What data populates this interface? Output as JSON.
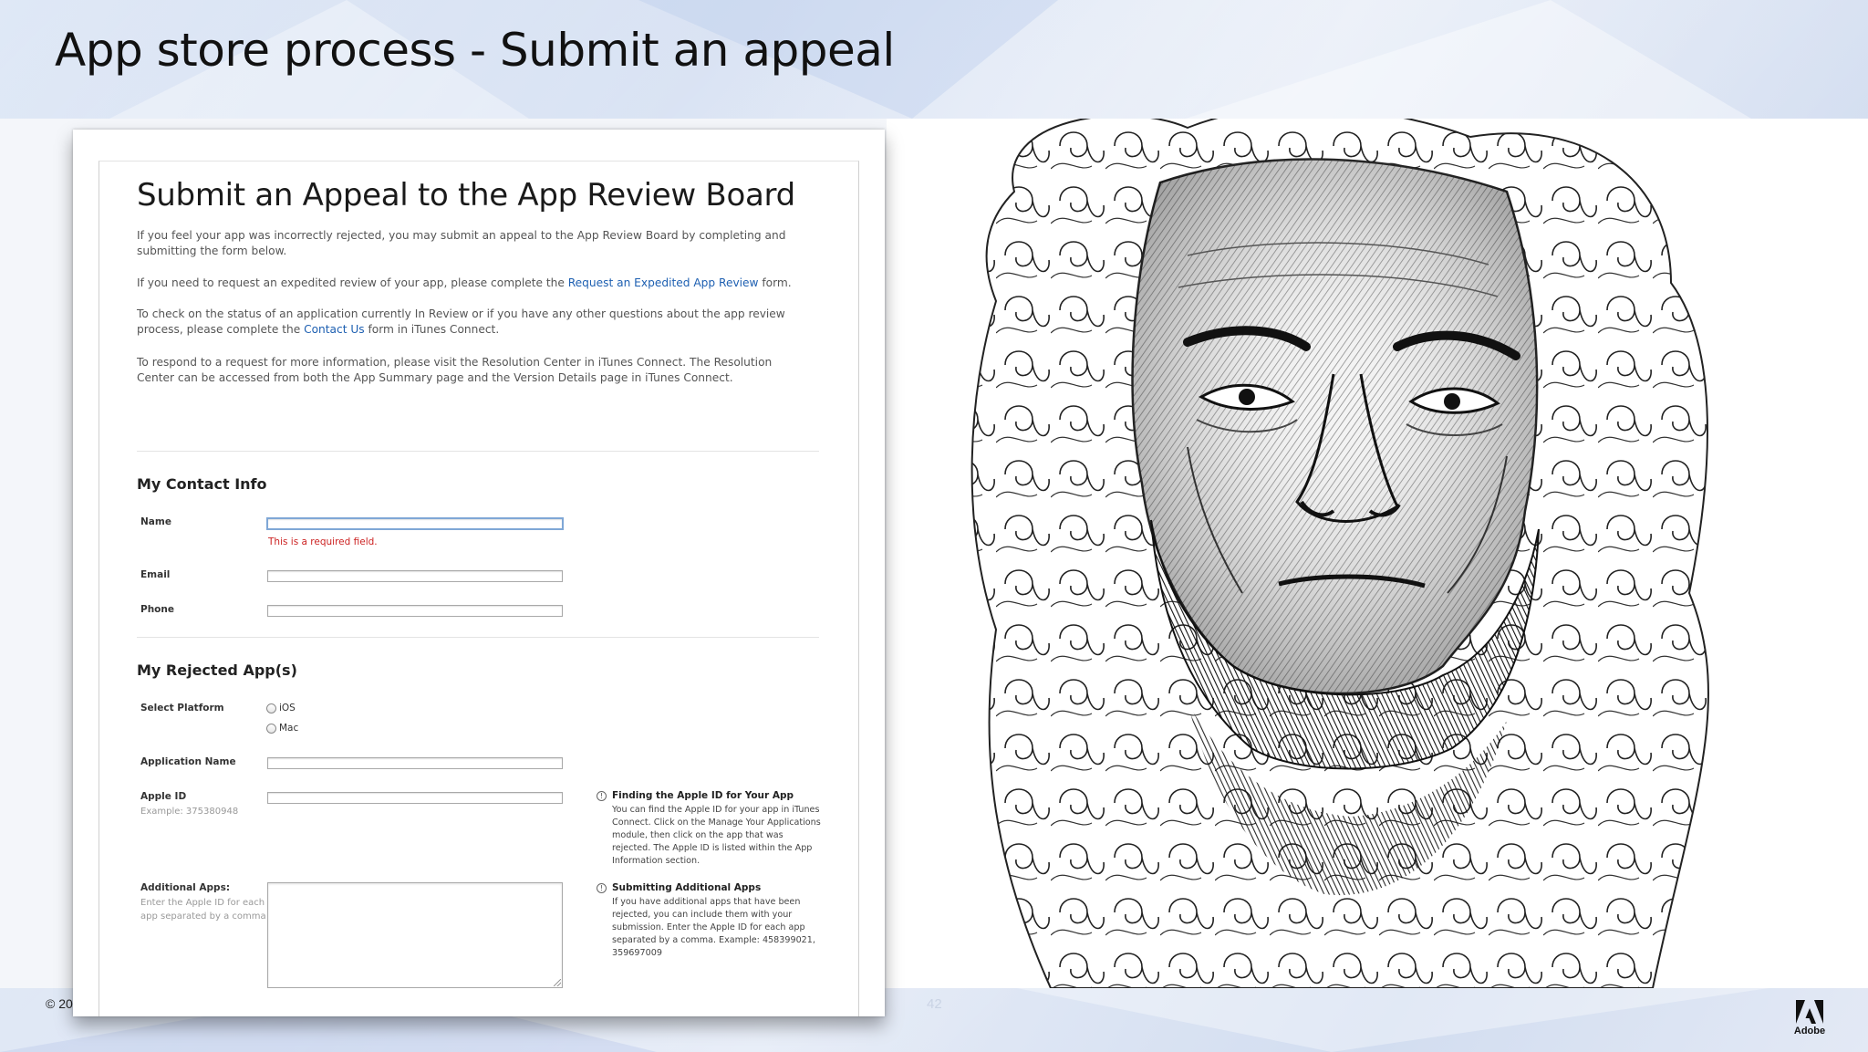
{
  "slide": {
    "title": "App store process - Submit an appeal",
    "copyright": "© 20",
    "page_number": "42",
    "brand": "Adobe"
  },
  "form": {
    "title": "Submit an Appeal to the App Review Board",
    "para1": "If you feel your app was incorrectly rejected, you may submit an appeal to the App Review Board by completing and submitting the form below.",
    "para2_before": "If you need to request an expedited review of your app, please complete the ",
    "para2_link": "Request an Expedited App Review",
    "para2_after": " form.",
    "para3_before": "To check on the status of an application currently In Review or if you have any other questions about the app review process, please complete the ",
    "para3_link": "Contact Us",
    "para3_after": " form in iTunes Connect.",
    "para4": "To respond to a request for more information, please visit the Resolution Center in iTunes Connect. The Resolution Center can be accessed from both the App Summary page and the Version Details page in iTunes Connect.",
    "contact_section": "My Contact Info",
    "name_label": "Name",
    "name_value": "",
    "name_error": "This is a required field.",
    "email_label": "Email",
    "email_value": "",
    "phone_label": "Phone",
    "phone_value": "",
    "apps_section": "My Rejected App(s)",
    "platform_label": "Select Platform",
    "platform_options": [
      "iOS",
      "Mac"
    ],
    "app_name_label": "Application Name",
    "app_name_value": "",
    "apple_id_label": "Apple ID",
    "apple_id_hint": "Example: 375380948",
    "apple_id_value": "",
    "additional_label": "Additional Apps:",
    "additional_hint": "Enter the Apple ID for each app separated by a comma",
    "additional_value": "",
    "help_apple_id_title": "Finding the Apple ID for Your App",
    "help_apple_id_body": "You can find the Apple ID for your app in iTunes Connect. Click on the Manage Your Applications module, then click on the app that was rejected. The Apple ID is listed within the App Information section.",
    "help_additional_title": "Submitting Additional Apps",
    "help_additional_body": "If you have additional apps that have been rejected, you can include them with your submission. Enter the Apple ID for each app separated by a comma. Example: 458399021, 359697009",
    "help_icon_glyph": "!"
  }
}
